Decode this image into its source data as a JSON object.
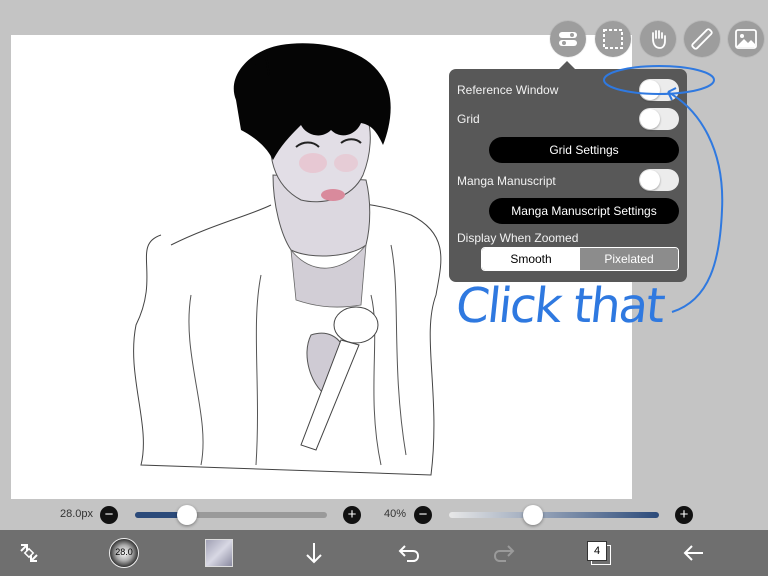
{
  "toolbar_top": {
    "icons": [
      "layer-settings-icon",
      "selection-icon",
      "hand-icon",
      "ruler-icon",
      "image-icon"
    ]
  },
  "popup": {
    "reference_window_label": "Reference Window",
    "grid_label": "Grid",
    "grid_settings_label": "Grid Settings",
    "manga_label": "Manga Manuscript",
    "manga_settings_label": "Manga Manuscript Settings",
    "display_zoomed_label": "Display When Zoomed",
    "smooth_label": "Smooth",
    "pixelated_label": "Pixelated",
    "selected_display": "Smooth"
  },
  "sliders": {
    "brush_size_label": "28.0px",
    "brush_size_value": 0.27,
    "opacity_label": "40%",
    "opacity_value": 0.4
  },
  "bottom_toolbar": {
    "brush_preview_label": "28.0",
    "layer_count": "4",
    "icons": [
      "transform-icon",
      "brush-icon",
      "color-swatch-icon",
      "download-icon",
      "undo-icon",
      "redo-icon",
      "layers-icon",
      "back-icon"
    ]
  },
  "annotation": {
    "text": "Click that",
    "color": "#2f79e0"
  },
  "colors": {
    "popup_bg": "#585858",
    "slider_fill": "#2b4a7a",
    "bottom_bar": "#6f6f6f"
  }
}
